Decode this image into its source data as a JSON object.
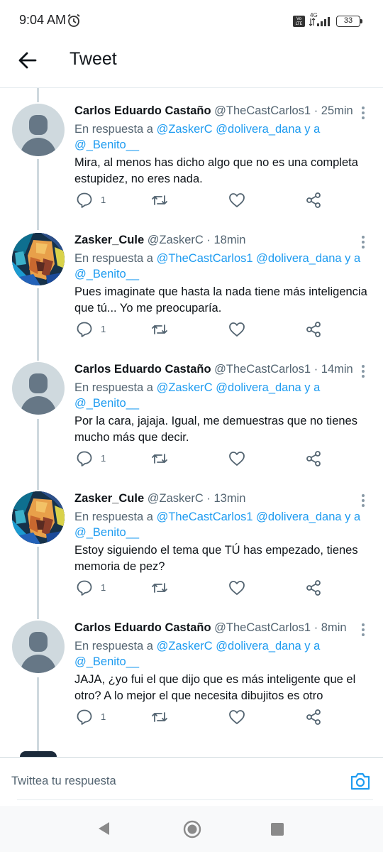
{
  "status": {
    "time": "9:04 AM",
    "volte": "Vo LTE",
    "network": "4G",
    "battery": "33"
  },
  "header": {
    "title": "Tweet"
  },
  "tweets": [
    {
      "display_name": "Carlos Eduardo Castaño",
      "handle": "@TheCastCarlos1",
      "time": "· 25min",
      "reply_prefix": "En respuesta a",
      "mention_1": "@ZaskerC",
      "mention_2": "@dolivera_dana",
      "reply_join": "y a",
      "mention_3": "@_Benito__",
      "text": "Mira, al menos has dicho algo que no es una completa estupidez, no eres nada.",
      "reply_count": "1",
      "avatar": "default-avatar"
    },
    {
      "display_name": "Zasker_Cule",
      "handle": "@ZaskerC",
      "time": "· 18min",
      "reply_prefix": "En respuesta a",
      "mention_1": "@TheCastCarlos1",
      "mention_2": "@dolivera_dana",
      "reply_join": "y a",
      "mention_3": "@_Benito__",
      "text": "Pues imaginate que hasta la nada tiene más inteligencia que tú... Yo me preocuparía.",
      "reply_count": "1",
      "avatar": "art-avatar"
    },
    {
      "display_name": "Carlos Eduardo Castaño",
      "handle": "@TheCastCarlos1",
      "time": "· 14min",
      "reply_prefix": "En respuesta a",
      "mention_1": "@ZaskerC",
      "mention_2": "@dolivera_dana",
      "reply_join": "y a",
      "mention_3": "@_Benito__",
      "text": "Por la cara, jajaja. Igual, me demuestras que no tienes mucho más que decir.",
      "reply_count": "1",
      "avatar": "default-avatar"
    },
    {
      "display_name": "Zasker_Cule",
      "handle": "@ZaskerC",
      "time": "· 13min",
      "reply_prefix": "En respuesta a",
      "mention_1": "@TheCastCarlos1",
      "mention_2": "@dolivera_dana",
      "reply_join": "y a",
      "mention_3": "@_Benito__",
      "text": "Estoy siguiendo el tema que TÚ has empezado, tienes memoria de pez?",
      "reply_count": "1",
      "avatar": "art-avatar"
    },
    {
      "display_name": "Carlos Eduardo Castaño",
      "handle": "@TheCastCarlos1",
      "time": "· 8min",
      "reply_prefix": "En respuesta a",
      "mention_1": "@ZaskerC",
      "mention_2": "@dolivera_dana",
      "reply_join": "y a",
      "mention_3": "@_Benito__",
      "text": "JAJA, ¿yo fui el que dijo que es más inteligente que el otro? A lo mejor el que necesita dibujitos es otro",
      "reply_count": "1",
      "avatar": "default-avatar"
    }
  ],
  "composer": {
    "placeholder": "Twittea tu respuesta"
  },
  "icons": {
    "back": "arrow-left-icon",
    "more": "more-vertical-icon",
    "reply": "reply-icon",
    "retweet": "retweet-icon",
    "like": "heart-icon",
    "share": "share-icon",
    "camera": "camera-icon"
  },
  "colors": {
    "link": "#1d9bf0",
    "secondary_text": "#536471",
    "primary_text": "#0f1419",
    "thread_line": "#cfd9de"
  }
}
